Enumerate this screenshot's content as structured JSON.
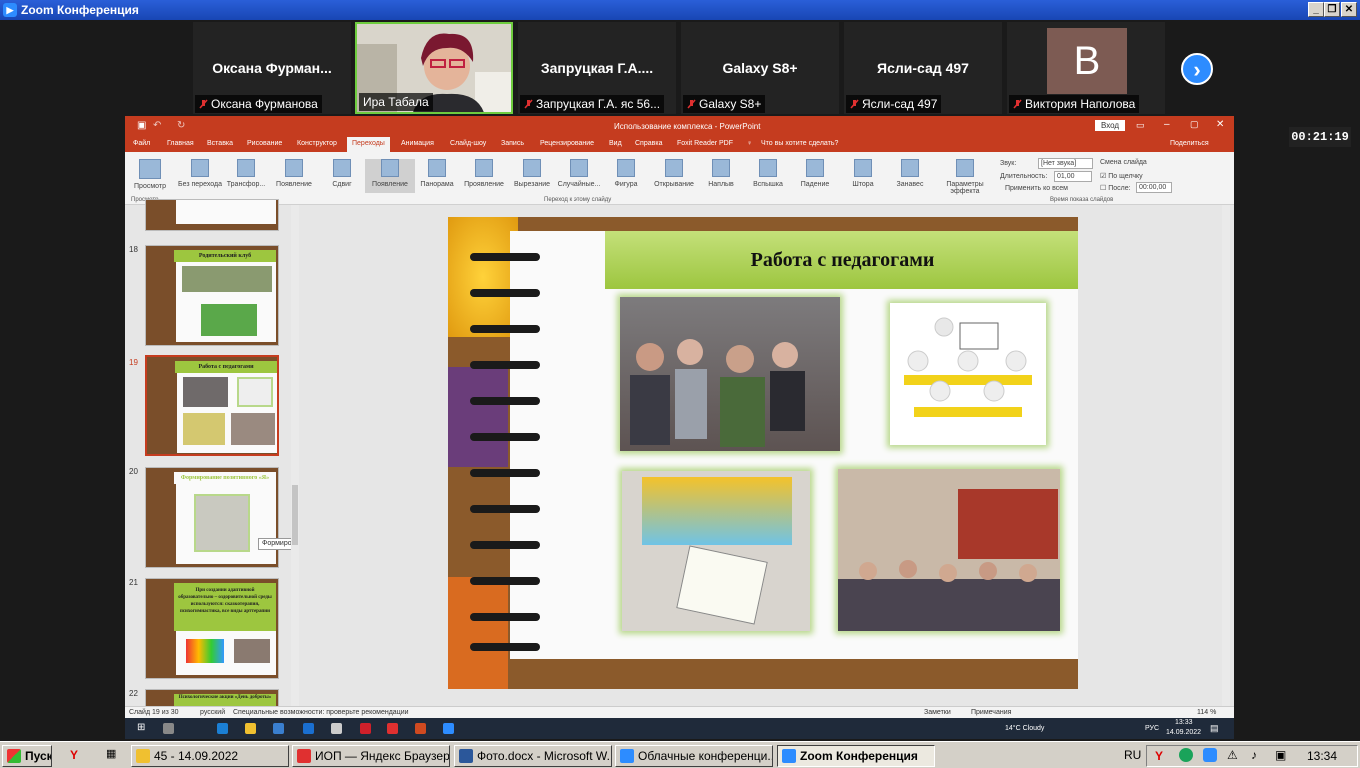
{
  "zoom": {
    "title": "Zoom Конференция",
    "timer": "00:21:19",
    "participants": [
      {
        "big": "Оксана  Фурман...",
        "label": "Оксана Фурманова"
      },
      {
        "big": "",
        "label": "Ира Табала"
      },
      {
        "big": "Запруцкая  Г.А....",
        "label": "Запруцкая Г.А. яс 56..."
      },
      {
        "big": "Galaxy S8+",
        "label": "Galaxy S8+"
      },
      {
        "big": "Ясли-сад 497",
        "label": "Ясли-сад 497"
      },
      {
        "big": "",
        "label": "Виктория Наполова",
        "avatar": "B"
      }
    ]
  },
  "ppt": {
    "title": "Использование комплекса - PowerPoint",
    "login": "Вход",
    "share": "Поделиться",
    "tabs": [
      "Файл",
      "Главная",
      "Вставка",
      "Рисование",
      "Конструктор",
      "Переходы",
      "Анимация",
      "Слайд-шоу",
      "Запись",
      "Рецензирование",
      "Вид",
      "Справка",
      "Foxit Reader PDF",
      "Что вы хотите сделать?"
    ],
    "preview": "Просмотр",
    "transitions": [
      "Без перехода",
      "Трансфор...",
      "Появление",
      "Сдвиг",
      "Появление",
      "Панорама",
      "Проявление",
      "Вырезание",
      "Случайные...",
      "Фигура",
      "Открывание",
      "Наплыв",
      "Вспышка",
      "Падение",
      "Штора",
      "Занавес"
    ],
    "effect_params": "Параметры эффекта",
    "timing": {
      "sound_label": "Звук:",
      "sound_value": "[Нет звука]",
      "duration_label": "Длительность:",
      "duration_value": "01,00",
      "apply_all": "Применить ко всем",
      "advance": "Смена слайда",
      "on_click": "По щелчку",
      "after": "После:",
      "after_value": "00:00,00"
    },
    "groups": {
      "preview": "Просмотр",
      "transition": "Переход к этому слайду",
      "timing": "Время показа слайдов"
    },
    "slides": [
      {
        "num": "18",
        "title": "Родительский клуб"
      },
      {
        "num": "19",
        "title": "Работа с педагогами"
      },
      {
        "num": "20",
        "title": "Формирование  позитивного «Я»"
      },
      {
        "num": "21",
        "title": "При создании адаптивной образовательно – оздоровительной среды используются: сказкотерапия, психогимнастика, все виды арттерапии"
      },
      {
        "num": "22",
        "title": "Психологические акции «День доброты»"
      }
    ],
    "tooltip": "Формирование позитивного...",
    "slide_title": "Работа с педагогами",
    "status": {
      "slide": "Слайд 19 из 30",
      "lang": "русский",
      "access": "Специальные возможности: проверьте рекомендации",
      "notes": "Заметки",
      "comments": "Примечания",
      "zoom": "114 %"
    }
  },
  "remote_taskbar": {
    "weather": "14°C  Cloudy",
    "lang": "РУС",
    "time": "13:33",
    "date": "14.09.2022"
  },
  "taskbar": {
    "start": "Пуск",
    "items": [
      "45 - 14.09.2022",
      "ИОП — Яндекс Браузер",
      "Фото.docx - Microsoft W...",
      "Облачные конференци...",
      "Zoom Конференция"
    ],
    "lang": "RU",
    "clock": "13:34"
  }
}
